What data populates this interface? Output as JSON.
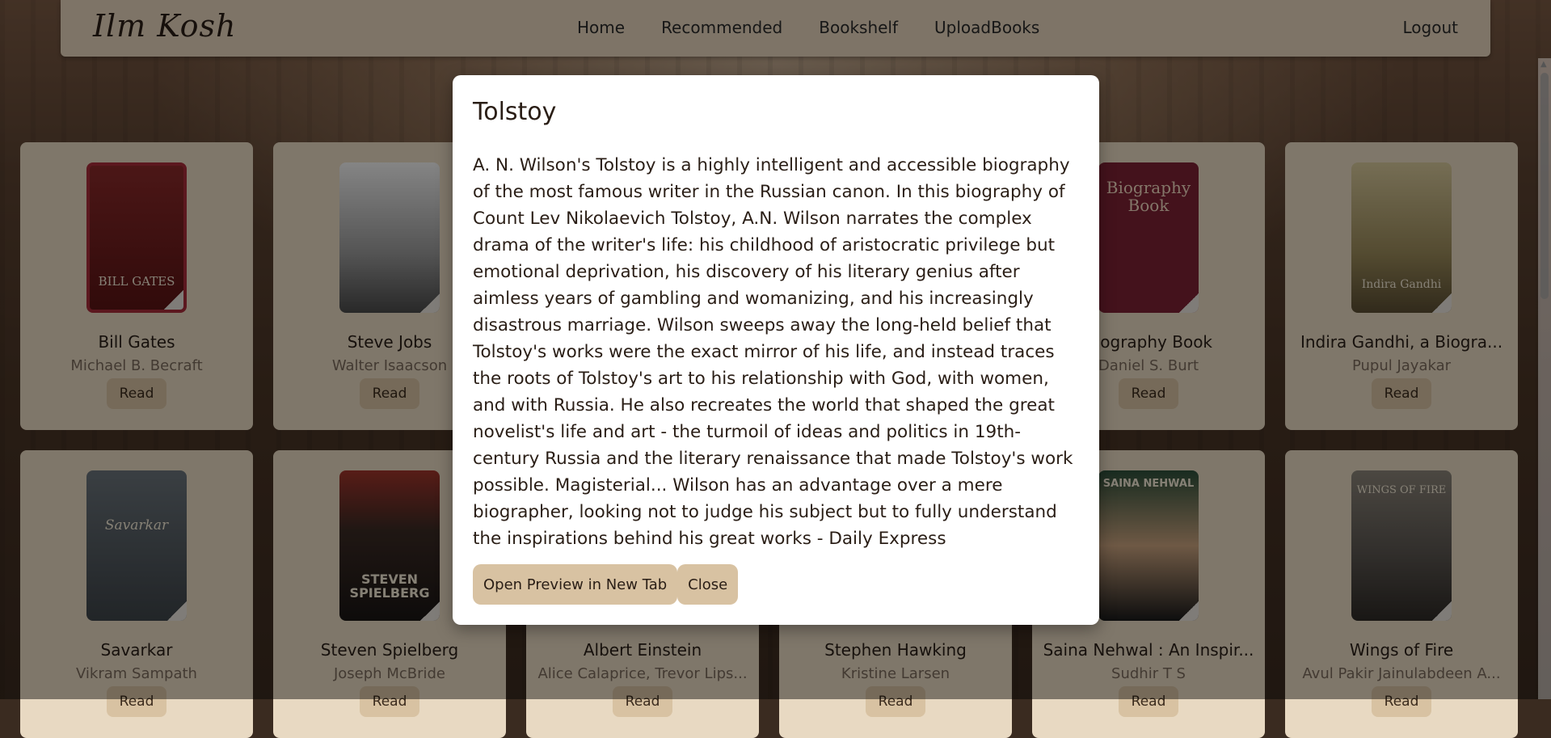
{
  "nav": {
    "logo": "Ilm Kosh",
    "links": [
      "Home",
      "Recommended",
      "Bookshelf",
      "UploadBooks"
    ],
    "logout": "Logout"
  },
  "books": [
    {
      "title": "Bill Gates",
      "author": "Michael B. Becraft",
      "cover_text": "BILL GATES",
      "cover_color": "#7a1c1c",
      "read_label": "Read"
    },
    {
      "title": "Steve Jobs",
      "author": "Walter Isaacson",
      "cover_text": "",
      "cover_color": "#d9d9d9",
      "read_label": "Read"
    },
    {
      "title": "",
      "author": "",
      "cover_text": "",
      "cover_color": "#6a4a30",
      "read_label": ""
    },
    {
      "title": "",
      "author": "",
      "cover_text": "",
      "cover_color": "#6a4a30",
      "read_label": ""
    },
    {
      "title": "Biography Book",
      "author": "Daniel S. Burt",
      "cover_text": "Biography Book",
      "cover_color": "#7c2233",
      "read_label": "Read"
    },
    {
      "title": "Indira Gandhi, a Biogra...",
      "author": "Pupul Jayakar",
      "cover_text": "Indira Gandhi",
      "cover_color": "#9a8a5a",
      "read_label": "Read"
    },
    {
      "title": "Savarkar",
      "author": "Vikram Sampath",
      "cover_text": "Savarkar",
      "cover_color": "#4a4f55",
      "read_label": "Read"
    },
    {
      "title": "Steven Spielberg",
      "author": "Joseph McBride",
      "cover_text": "STEVEN SPIELBERG",
      "cover_color": "#2a2523",
      "read_label": "Read"
    },
    {
      "title": "Albert Einstein",
      "author": "Alice Calaprice, Trevor Lips...",
      "cover_text": "",
      "cover_color": "#8a7a66",
      "read_label": "Read"
    },
    {
      "title": "Stephen Hawking",
      "author": "Kristine Larsen",
      "cover_text": "",
      "cover_color": "#3a4050",
      "read_label": "Read"
    },
    {
      "title": "Saina Nehwal : An Inspir...",
      "author": "Sudhir T S",
      "cover_text": "SAINA NEHWAL",
      "cover_color": "#2f4a2f",
      "read_label": "Read"
    },
    {
      "title": "Wings of Fire",
      "author": "Avul Pakir Jainulabdeen A...",
      "cover_text": "WINGS OF FIRE",
      "cover_color": "#5a5550",
      "read_label": "Read"
    }
  ],
  "modal": {
    "title": "Tolstoy",
    "description": "A. N. Wilson's Tolstoy is a highly intelligent and accessible biography of the most famous writer in the Russian canon. In this biography of Count Lev Nikolaevich Tolstoy, A.N. Wilson narrates the complex drama of the writer's life: his childhood of aristocratic privilege but emotional deprivation, his discovery of his literary genius after aimless years of gambling and womanizing, and his increasingly disastrous marriage. Wilson sweeps away the long-held belief that Tolstoy's works were the exact mirror of his life, and instead traces the roots of Tolstoy's art to his relationship with God, with women, and with Russia. He also recreates the world that shaped the great novelist's life and art - the turmoil of ideas and politics in 19th-century Russia and the literary renaissance that made Tolstoy's work possible. Magisterial... Wilson has an advantage over a mere biographer, looking not to judge his subject but to fully understand the inspirations behind his great works - Daily Express",
    "preview_button": "Open Preview in New Tab",
    "close_button": "Close"
  },
  "colors": {
    "nav_bg": "#e6d4bc",
    "card_bg": "#e8d9c2",
    "button_bg": "#d8c2a2",
    "overlay": "rgba(0,0,0,0.45)"
  }
}
